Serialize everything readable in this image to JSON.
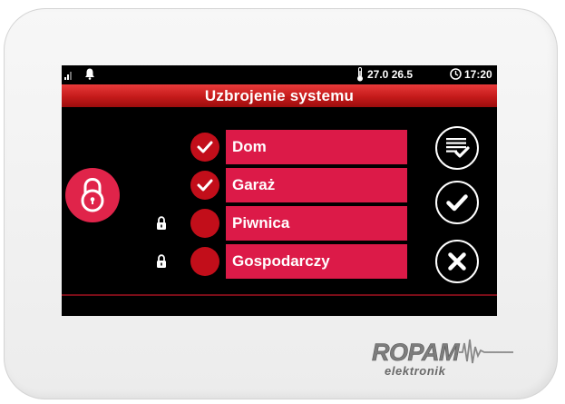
{
  "status": {
    "temperature": "27.0 26.5",
    "time": "17:20",
    "signal_icon": "signal-bars-icon",
    "bell_icon": "bell-icon",
    "thermometer_icon": "thermometer-icon",
    "clock_icon": "clock-icon"
  },
  "header": {
    "title": "Uzbrojenie systemu"
  },
  "zones": [
    {
      "label": "Dom",
      "checked": true,
      "locked": false
    },
    {
      "label": "Garaż",
      "checked": true,
      "locked": false
    },
    {
      "label": "Piwnica",
      "checked": false,
      "locked": true
    },
    {
      "label": "Gospodarczy",
      "checked": false,
      "locked": true
    }
  ],
  "actions": {
    "select_all_icon": "checklist-icon",
    "confirm_icon": "check-icon",
    "cancel_icon": "close-icon",
    "arm_icon": "padlock-icon"
  },
  "brand": {
    "name": "ROPAM",
    "subtitle": "elektronik"
  },
  "colors": {
    "accent": "#dc1a48",
    "title_bar": "#c41a1a",
    "background": "#000000",
    "dot": "#c20e1a"
  }
}
